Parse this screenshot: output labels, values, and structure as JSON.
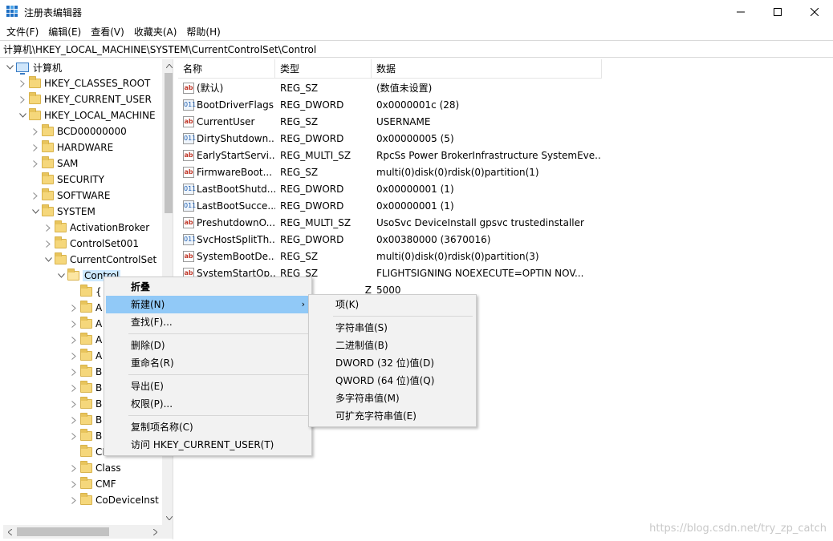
{
  "window": {
    "title": "注册表编辑器",
    "controls": {
      "minimize": "minimize",
      "maximize": "maximize",
      "close": "close"
    }
  },
  "menu": [
    "文件(F)",
    "编辑(E)",
    "查看(V)",
    "收藏夹(A)",
    "帮助(H)"
  ],
  "address": "计算机\\HKEY_LOCAL_MACHINE\\SYSTEM\\CurrentControlSet\\Control",
  "tree": {
    "root": "计算机",
    "hives": [
      "HKEY_CLASSES_ROOT",
      "HKEY_CURRENT_USER",
      "HKEY_LOCAL_MACHINE"
    ],
    "hklm_children": [
      "BCD00000000",
      "HARDWARE",
      "SAM",
      "SECURITY",
      "SOFTWARE",
      "SYSTEM"
    ],
    "system_children": [
      "ActivationBroker",
      "ControlSet001",
      "CurrentControlSet"
    ],
    "selected": "Control",
    "control_children": [
      "{",
      "A",
      "A",
      "A",
      "A",
      "B",
      "B",
      "B",
      "B",
      "B",
      "CI",
      "Class",
      "CMF",
      "CoDeviceInst"
    ]
  },
  "list": {
    "headers": {
      "name": "名称",
      "type": "类型",
      "data": "数据"
    },
    "rows": [
      {
        "icon": "string-value-icon",
        "name": "(默认)",
        "type": "REG_SZ",
        "data": "(数值未设置)"
      },
      {
        "icon": "binary-value-icon",
        "name": "BootDriverFlags",
        "type": "REG_DWORD",
        "data": "0x0000001c (28)"
      },
      {
        "icon": "string-value-icon",
        "name": "CurrentUser",
        "type": "REG_SZ",
        "data": "USERNAME"
      },
      {
        "icon": "binary-value-icon",
        "name": "DirtyShutdown...",
        "type": "REG_DWORD",
        "data": "0x00000005 (5)"
      },
      {
        "icon": "string-value-icon",
        "name": "EarlyStartServi...",
        "type": "REG_MULTI_SZ",
        "data": "RpcSs Power BrokerInfrastructure SystemEve..."
      },
      {
        "icon": "string-value-icon",
        "name": "FirmwareBoot...",
        "type": "REG_SZ",
        "data": "multi(0)disk(0)rdisk(0)partition(1)"
      },
      {
        "icon": "binary-value-icon",
        "name": "LastBootShutd...",
        "type": "REG_DWORD",
        "data": "0x00000001 (1)"
      },
      {
        "icon": "binary-value-icon",
        "name": "LastBootSucce...",
        "type": "REG_DWORD",
        "data": "0x00000001 (1)"
      },
      {
        "icon": "string-value-icon",
        "name": "PreshutdownO...",
        "type": "REG_MULTI_SZ",
        "data": "UsoSvc DeviceInstall gpsvc trustedinstaller"
      },
      {
        "icon": "binary-value-icon",
        "name": "SvcHostSplitTh...",
        "type": "REG_DWORD",
        "data": "0x00380000 (3670016)"
      },
      {
        "icon": "string-value-icon",
        "name": "SystemBootDe...",
        "type": "REG_SZ",
        "data": "multi(0)disk(0)rdisk(0)partition(3)"
      },
      {
        "icon": "string-value-icon",
        "name": "SystemStartOp...",
        "type": "REG_SZ",
        "data": " FLIGHTSIGNING  NOEXECUTE=OPTIN  NOV..."
      },
      {
        "icon": "string-value-icon",
        "name": "",
        "type": "Z",
        "data": "5000"
      }
    ]
  },
  "context_menu": {
    "collapse": "折叠",
    "new": "新建(N)",
    "find": "查找(F)...",
    "delete": "删除(D)",
    "rename": "重命名(R)",
    "export": "导出(E)",
    "permissions": "权限(P)...",
    "copy_key_name": "复制项名称(C)",
    "visit": "访问 HKEY_CURRENT_USER(T)"
  },
  "submenu": {
    "key": "项(K)",
    "string": "字符串值(S)",
    "binary": "二进制值(B)",
    "dword": "DWORD (32 位)值(D)",
    "qword": "QWORD (64 位)值(Q)",
    "multi_string": "多字符串值(M)",
    "expand_string": "可扩充字符串值(E)"
  },
  "watermark": "https://blog.csdn.net/try_zp_catch"
}
